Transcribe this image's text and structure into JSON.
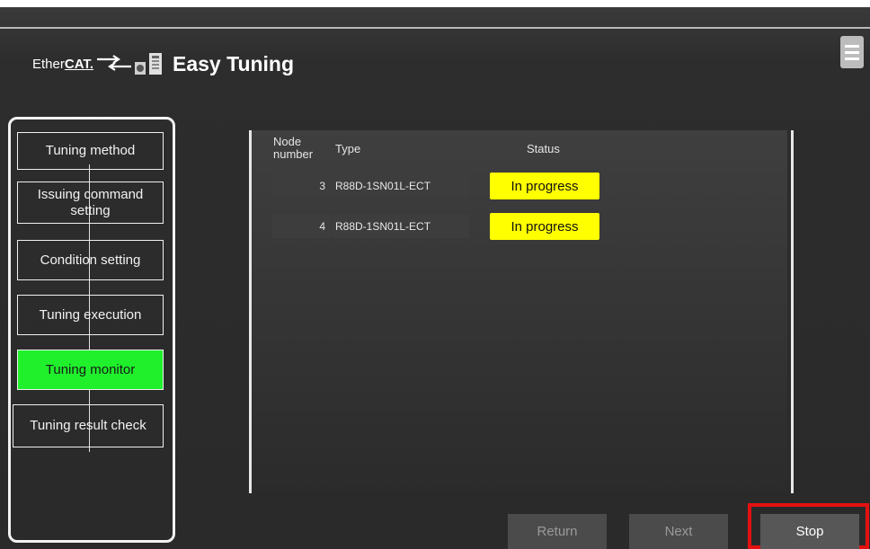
{
  "app": {
    "logo_ether": "Ether",
    "logo_cat": "CAT.",
    "title": "Easy Tuning"
  },
  "steps": [
    {
      "label": "Tuning method",
      "active": false
    },
    {
      "label": "Issuing command setting",
      "active": false
    },
    {
      "label": "Condition setting",
      "active": false
    },
    {
      "label": "Tuning execution",
      "active": false
    },
    {
      "label": "Tuning monitor",
      "active": true
    },
    {
      "label": "Tuning result check",
      "active": false
    }
  ],
  "table": {
    "headers": {
      "node_number": "Node number",
      "type": "Type",
      "status": "Status"
    },
    "rows": [
      {
        "node": "3",
        "type": "R88D-1SN01L-ECT",
        "status": "In progress"
      },
      {
        "node": "4",
        "type": "R88D-1SN01L-ECT",
        "status": "In progress"
      }
    ]
  },
  "buttons": {
    "return": "Return",
    "next": "Next",
    "stop": "Stop"
  },
  "colors": {
    "active_step": "#1ff02b",
    "status_in_progress": "#ffff00",
    "stop_highlight": "#e41111"
  },
  "icons": [
    "ethercat-arrows-icon",
    "servo-drive-icon",
    "menu-icon"
  ]
}
